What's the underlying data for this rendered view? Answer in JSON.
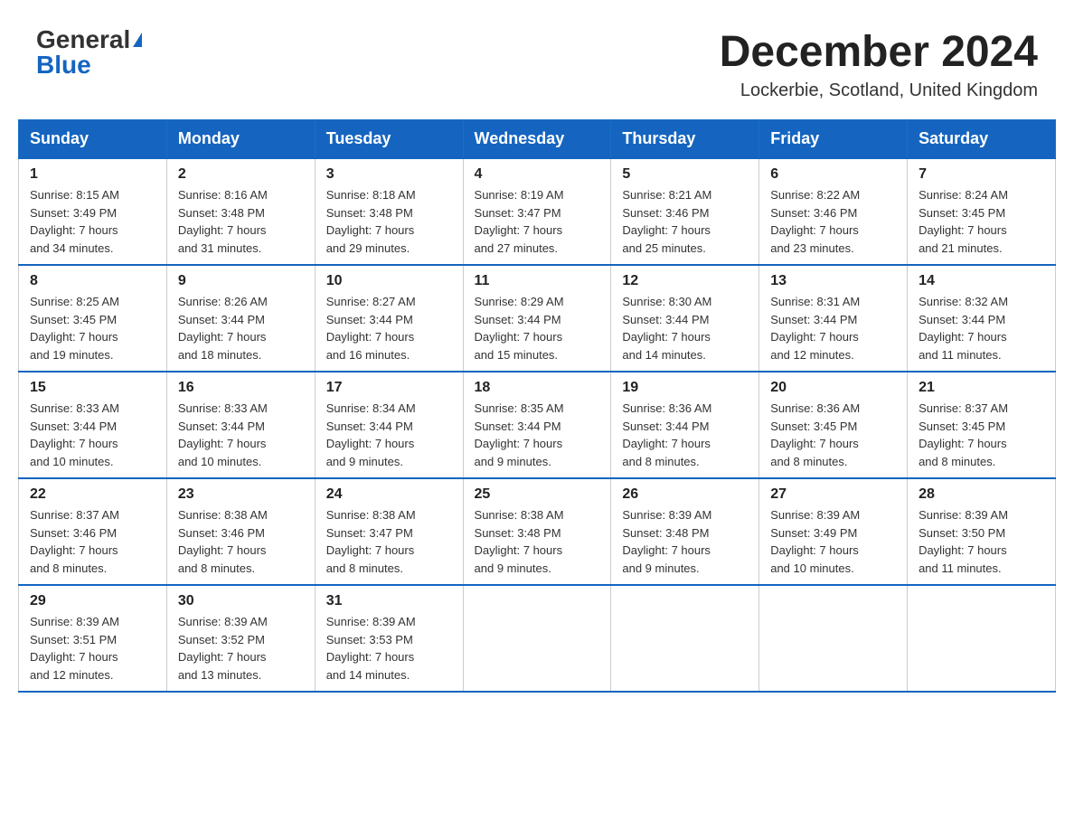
{
  "header": {
    "logo_general": "General",
    "logo_blue": "Blue",
    "title": "December 2024",
    "location": "Lockerbie, Scotland, United Kingdom"
  },
  "weekdays": [
    "Sunday",
    "Monday",
    "Tuesday",
    "Wednesday",
    "Thursday",
    "Friday",
    "Saturday"
  ],
  "weeks": [
    [
      {
        "day": "1",
        "sunrise": "8:15 AM",
        "sunset": "3:49 PM",
        "daylight": "7 hours and 34 minutes."
      },
      {
        "day": "2",
        "sunrise": "8:16 AM",
        "sunset": "3:48 PM",
        "daylight": "7 hours and 31 minutes."
      },
      {
        "day": "3",
        "sunrise": "8:18 AM",
        "sunset": "3:48 PM",
        "daylight": "7 hours and 29 minutes."
      },
      {
        "day": "4",
        "sunrise": "8:19 AM",
        "sunset": "3:47 PM",
        "daylight": "7 hours and 27 minutes."
      },
      {
        "day": "5",
        "sunrise": "8:21 AM",
        "sunset": "3:46 PM",
        "daylight": "7 hours and 25 minutes."
      },
      {
        "day": "6",
        "sunrise": "8:22 AM",
        "sunset": "3:46 PM",
        "daylight": "7 hours and 23 minutes."
      },
      {
        "day": "7",
        "sunrise": "8:24 AM",
        "sunset": "3:45 PM",
        "daylight": "7 hours and 21 minutes."
      }
    ],
    [
      {
        "day": "8",
        "sunrise": "8:25 AM",
        "sunset": "3:45 PM",
        "daylight": "7 hours and 19 minutes."
      },
      {
        "day": "9",
        "sunrise": "8:26 AM",
        "sunset": "3:44 PM",
        "daylight": "7 hours and 18 minutes."
      },
      {
        "day": "10",
        "sunrise": "8:27 AM",
        "sunset": "3:44 PM",
        "daylight": "7 hours and 16 minutes."
      },
      {
        "day": "11",
        "sunrise": "8:29 AM",
        "sunset": "3:44 PM",
        "daylight": "7 hours and 15 minutes."
      },
      {
        "day": "12",
        "sunrise": "8:30 AM",
        "sunset": "3:44 PM",
        "daylight": "7 hours and 14 minutes."
      },
      {
        "day": "13",
        "sunrise": "8:31 AM",
        "sunset": "3:44 PM",
        "daylight": "7 hours and 12 minutes."
      },
      {
        "day": "14",
        "sunrise": "8:32 AM",
        "sunset": "3:44 PM",
        "daylight": "7 hours and 11 minutes."
      }
    ],
    [
      {
        "day": "15",
        "sunrise": "8:33 AM",
        "sunset": "3:44 PM",
        "daylight": "7 hours and 10 minutes."
      },
      {
        "day": "16",
        "sunrise": "8:33 AM",
        "sunset": "3:44 PM",
        "daylight": "7 hours and 10 minutes."
      },
      {
        "day": "17",
        "sunrise": "8:34 AM",
        "sunset": "3:44 PM",
        "daylight": "7 hours and 9 minutes."
      },
      {
        "day": "18",
        "sunrise": "8:35 AM",
        "sunset": "3:44 PM",
        "daylight": "7 hours and 9 minutes."
      },
      {
        "day": "19",
        "sunrise": "8:36 AM",
        "sunset": "3:44 PM",
        "daylight": "7 hours and 8 minutes."
      },
      {
        "day": "20",
        "sunrise": "8:36 AM",
        "sunset": "3:45 PM",
        "daylight": "7 hours and 8 minutes."
      },
      {
        "day": "21",
        "sunrise": "8:37 AM",
        "sunset": "3:45 PM",
        "daylight": "7 hours and 8 minutes."
      }
    ],
    [
      {
        "day": "22",
        "sunrise": "8:37 AM",
        "sunset": "3:46 PM",
        "daylight": "7 hours and 8 minutes."
      },
      {
        "day": "23",
        "sunrise": "8:38 AM",
        "sunset": "3:46 PM",
        "daylight": "7 hours and 8 minutes."
      },
      {
        "day": "24",
        "sunrise": "8:38 AM",
        "sunset": "3:47 PM",
        "daylight": "7 hours and 8 minutes."
      },
      {
        "day": "25",
        "sunrise": "8:38 AM",
        "sunset": "3:48 PM",
        "daylight": "7 hours and 9 minutes."
      },
      {
        "day": "26",
        "sunrise": "8:39 AM",
        "sunset": "3:48 PM",
        "daylight": "7 hours and 9 minutes."
      },
      {
        "day": "27",
        "sunrise": "8:39 AM",
        "sunset": "3:49 PM",
        "daylight": "7 hours and 10 minutes."
      },
      {
        "day": "28",
        "sunrise": "8:39 AM",
        "sunset": "3:50 PM",
        "daylight": "7 hours and 11 minutes."
      }
    ],
    [
      {
        "day": "29",
        "sunrise": "8:39 AM",
        "sunset": "3:51 PM",
        "daylight": "7 hours and 12 minutes."
      },
      {
        "day": "30",
        "sunrise": "8:39 AM",
        "sunset": "3:52 PM",
        "daylight": "7 hours and 13 minutes."
      },
      {
        "day": "31",
        "sunrise": "8:39 AM",
        "sunset": "3:53 PM",
        "daylight": "7 hours and 14 minutes."
      },
      null,
      null,
      null,
      null
    ]
  ],
  "labels": {
    "sunrise": "Sunrise:",
    "sunset": "Sunset:",
    "daylight": "Daylight:"
  }
}
